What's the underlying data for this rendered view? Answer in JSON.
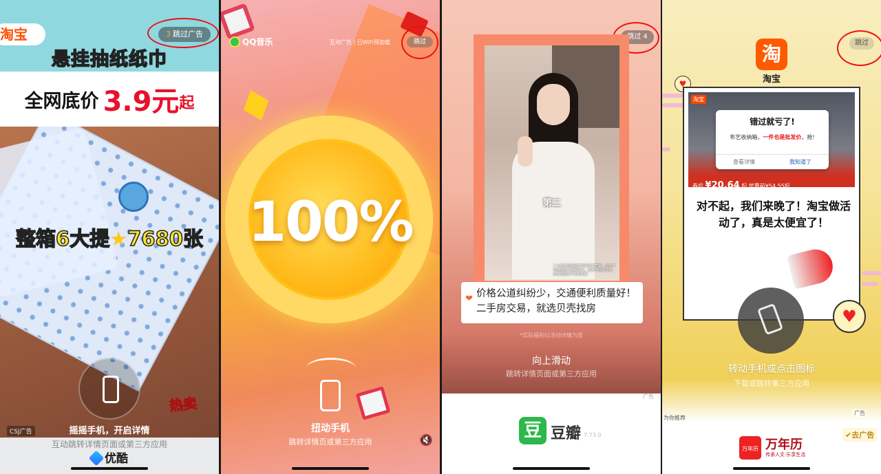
{
  "panel1": {
    "brand_partial": "淘宝",
    "skip": {
      "count": "3",
      "label": "跳过广告"
    },
    "headline": "悬挂抽纸纸巾",
    "price_prefix": "全网底价",
    "price_value": "3.9元",
    "price_suffix": "起",
    "box_text_a": "整箱6大提",
    "box_text_star": "★",
    "box_text_b": "7680张",
    "hot_label": "热卖",
    "action_main": "摇摇手机，开启详情",
    "action_sub": "互动跳转详情页面或第三方应用",
    "csj_tag": "CSJ广告",
    "app_name": "优酷"
  },
  "panel2": {
    "app_name": "QQ音乐",
    "top_links": "互动广告 | 已WiFi预加载",
    "skip_label": "跳过",
    "percent": "100%",
    "action_main": "扭动手机",
    "action_sub": "跳转详情页或第三方应用",
    "mute_icon": "🔇"
  },
  "panel3": {
    "skip_label": "跳过 4",
    "video_caption": "第二",
    "video_subcaption": "广州城市副规则打造有利于营销，现在不同楼盘的价格差异大，逐步形成差异化，建议搭配APP实地考察",
    "bubble_text": "价格公道纠纷少，交通便利质量好！二手房交易，就选贝壳找房",
    "disclaimer": "*实际福利以活动详情为准",
    "action_main": "向上滑动",
    "action_sub": "跳转详情页面或第三方应用",
    "ad_tag": "广告",
    "app_icon_char": "豆",
    "app_name": "豆瓣",
    "version": "7.73.0"
  },
  "panel4": {
    "app_icon_char": "淘",
    "app_name": "淘宝",
    "skip_label": "跳过",
    "img_tag": "淘宝",
    "popup_title": "错过就亏了!",
    "popup_body_a": "布艺收纳箱，",
    "popup_body_red": "一件也是批发价",
    "popup_body_b": "，抢!",
    "popup_btn_left": "查看详情",
    "popup_btn_right": "我知道了",
    "price_label": "券后",
    "price_value": "¥20.64",
    "price_orig": "起 优惠前¥54.55起",
    "card_text": "对不起，我们来晚了！淘宝做活动了，真是太便宜了！",
    "action_main": "转动手机或点击图标",
    "action_sub": "下载或跳转第三方应用",
    "recommend": "为你推荐",
    "ad_tag": "广告",
    "calendar_icon_text": "万年历",
    "calendar_name": "万年历",
    "calendar_slogan": "传承人文·乐享生活",
    "go_ad": "✔去广告"
  }
}
